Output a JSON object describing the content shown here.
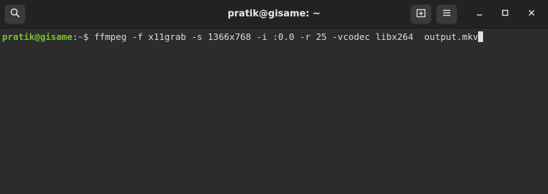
{
  "window": {
    "title": "pratik@gisame: ~"
  },
  "icons": {
    "search": "search-icon",
    "new_tab": "new-tab-icon",
    "menu": "hamburger-menu-icon",
    "minimize": "minimize-icon",
    "maximize": "maximize-icon",
    "close": "close-icon"
  },
  "terminal": {
    "prompt_user_host": "pratik@gisame",
    "prompt_sep": ":",
    "prompt_path": "~",
    "prompt_symbol": "$ ",
    "command": "ffmpeg -f x11grab -s 1366x768 -i :0.0 -r 25 -vcodec libx264  output.mkv"
  },
  "colors": {
    "titlebar_bg": "#222222",
    "terminal_bg": "#2c2c2c",
    "prompt_user_host": "#7ac02a",
    "prompt_path": "#5b8ed4",
    "text": "#d9d9d9"
  }
}
